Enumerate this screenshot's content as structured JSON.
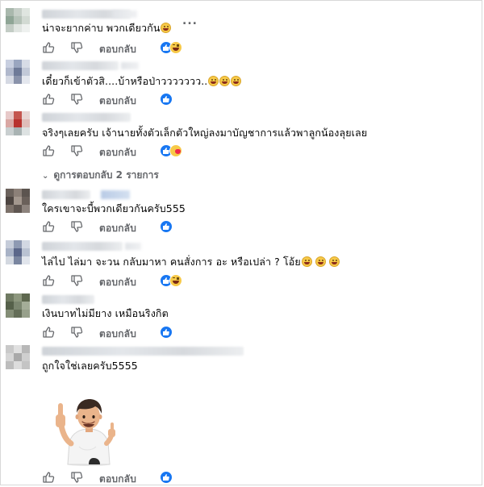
{
  "comments": [
    {
      "text": "น่าจะยากค่าบ พวกเดียวกัน",
      "reply_label": "ตอบกลับ",
      "reactions": [
        "like",
        "haha"
      ]
    },
    {
      "text": "เดี๋ยวก็เข้าตัวสิ....บ้าหรือป่าววววววว..",
      "reply_label": "ตอบกลับ",
      "reactions": [
        "like"
      ]
    },
    {
      "text": "จริงๆเลยครับ เจ้านายทั้งตัวเล็กตัวใหญ่ลงมาบัญชาการแล้วพาลูกน้องลุยเลย",
      "reply_label": "ตอบกลับ",
      "reactions": [
        "like",
        "care"
      ]
    },
    {
      "text": "ใครเขาจะบี้พวกเดียวกันครับ555",
      "reply_label": "ตอบกลับ",
      "reactions": [
        "like"
      ]
    },
    {
      "text": "ไล่ไป ไล่มา จะวน กลับมาหา คนสั่งการ อะ หรือเปล่า ? โอ้ย",
      "reply_label": "ตอบกลับ",
      "reactions": [
        "like",
        "haha"
      ]
    },
    {
      "text": "เงินบาทไม่มียาง เหมือนริงกิต",
      "reply_label": "ตอบกลับ",
      "reactions": [
        "like"
      ]
    },
    {
      "text": "ถูกใจใช่เลยครับ5555",
      "reply_label": "ตอบกลับ",
      "reactions": [
        "like"
      ]
    }
  ],
  "view_replies_label": "ดูการตอบกลับ 2 รายการ",
  "more_options_label": "...",
  "icons": {
    "like_action": "thumbs-up-icon",
    "dislike_action": "thumbs-down-icon",
    "like_reaction": "like-reaction-icon",
    "haha_reaction": "haha-reaction-icon",
    "care_reaction": "care-reaction-icon",
    "emoji": "grinning-emoji-icon",
    "sticker": "thumbs-up-man-sticker"
  },
  "colors": {
    "like_blue": "#1877f2",
    "secondary_text": "#65676b",
    "emoji_yellow": "#f7c948"
  }
}
